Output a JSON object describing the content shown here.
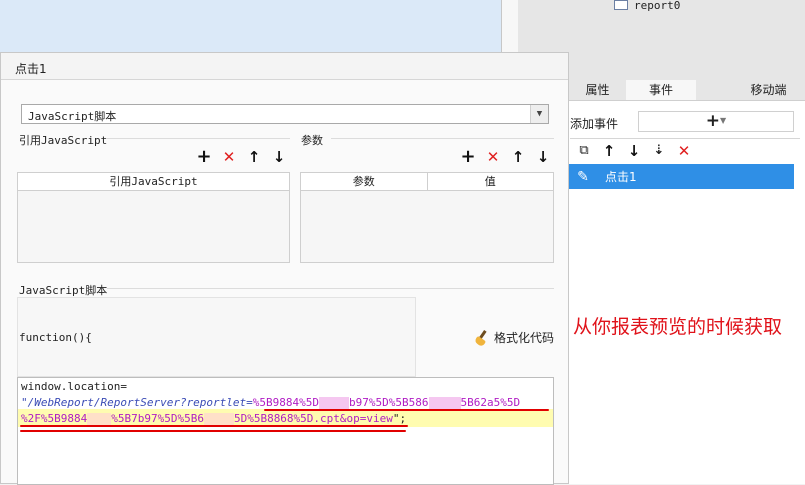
{
  "tree": {
    "item": "report0"
  },
  "dialog": {
    "title": "点击1",
    "script_type": "JavaScript脚本",
    "ref_js_section": "引用JavaScript",
    "params_section": "参数",
    "ref_table_header": "引用JavaScript",
    "params_headers": [
      "参数",
      "值"
    ],
    "script_section": "JavaScript脚本",
    "function_head": "function(){",
    "format_button": "格式化代码",
    "code": {
      "line1": "window.location=",
      "line2_a": "\"/WebReport/ReportServer?reportlet=",
      "line2_b": "%5B9884%5D",
      "line2_c": "b97%5D%5B586",
      "line2_d": "5B62a5%5D",
      "line3_a": "%2F%5B9884",
      "line3_b": "%5B7b97%5D%5B6",
      "line3_c": "5D%5B8868%5D.cpt&op=view",
      "line3_d": "\";"
    }
  },
  "right_panel": {
    "tabs": [
      "属性",
      "事件",
      "移动端"
    ],
    "active_tab": "事件",
    "add_event_label": "添加事件",
    "add_event_button": "+",
    "event_item": "点击1"
  },
  "annotation": "从你报表预览的时候获取",
  "colors": {
    "accent": "#2f8fe6",
    "delete": "#e02020",
    "annotation": "#e0121a",
    "code_string": "#b01cc4",
    "code_keyword": "#3a4bb5"
  }
}
